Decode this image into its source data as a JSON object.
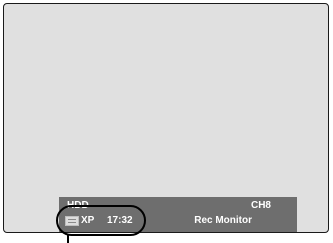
{
  "osd": {
    "source": "HDD",
    "channel": "CH8",
    "rec_icon": "recording-info-icon",
    "rec_mode": "XP",
    "remaining_time": "17:32",
    "mode_label": "Rec Monitor"
  },
  "colors": {
    "screen_bg": "#e0e0e0",
    "osd_bar": "#6e6e6e",
    "osd_text": "#ffffff",
    "callout": "#000000"
  }
}
